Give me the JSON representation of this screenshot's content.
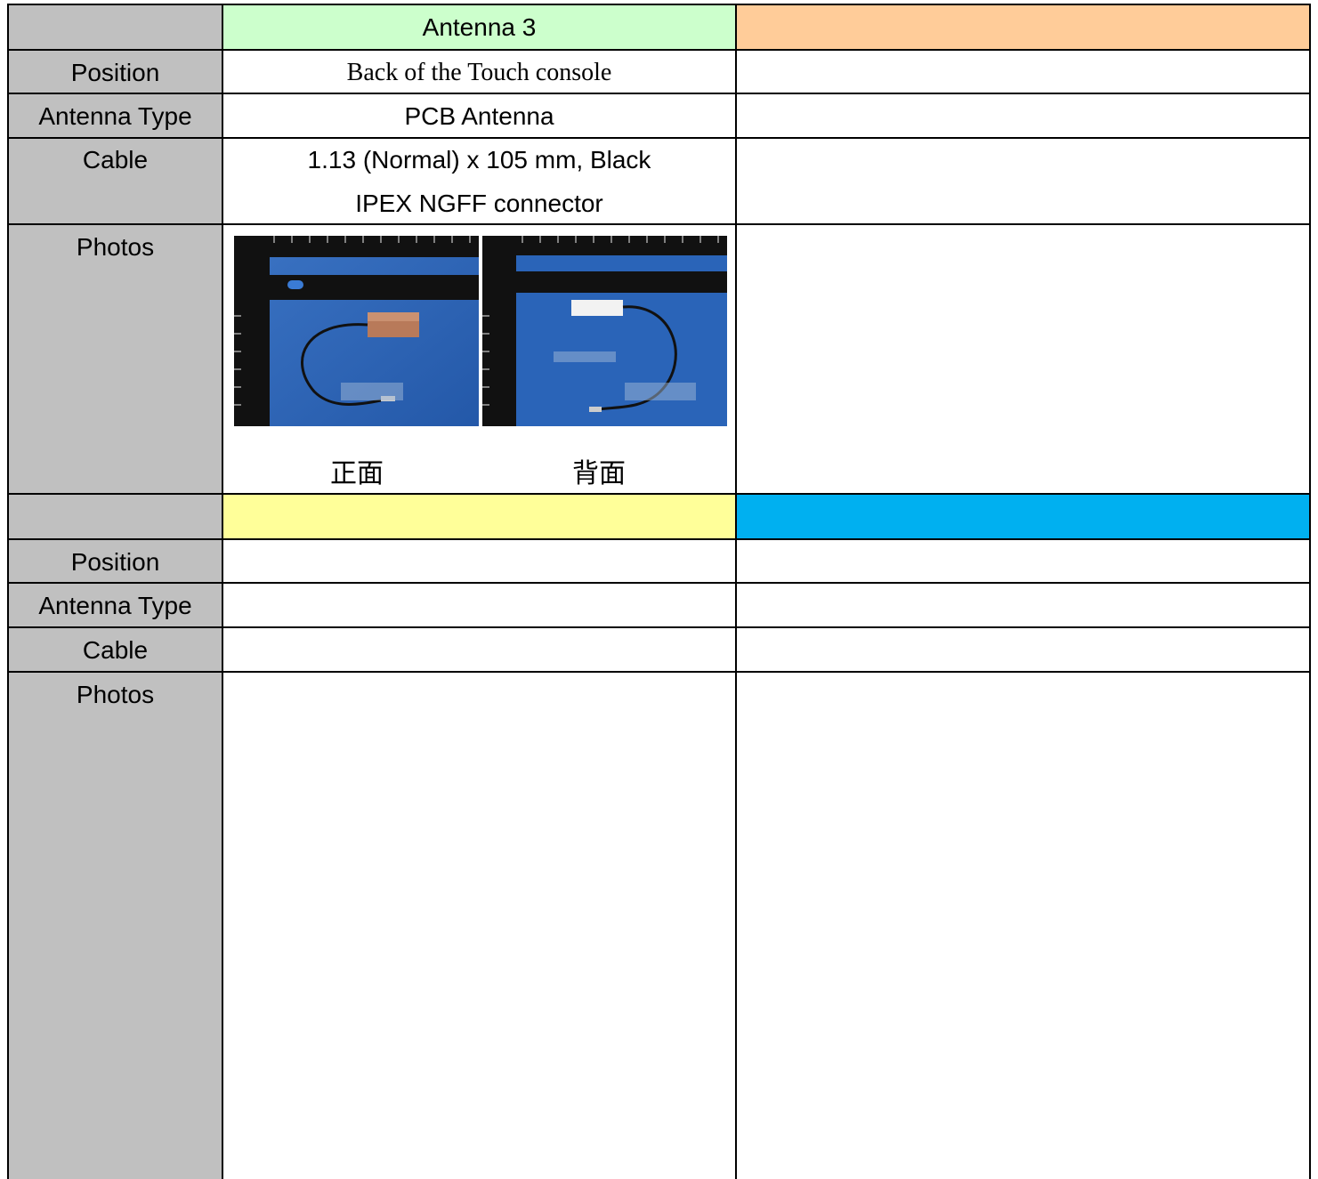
{
  "top_block": {
    "header": "Antenna 3",
    "labels": {
      "position": "Position",
      "antenna_type": "Antenna Type",
      "cable": "Cable",
      "photos": "Photos"
    },
    "position": "Back of the Touch console",
    "antenna_type": "PCB Antenna",
    "cable_lines": [
      "1.13 (Normal) x 105 mm, Black",
      "IPEX NGFF connector"
    ],
    "photo_captions": [
      "正面",
      "背面"
    ]
  },
  "bottom_block": {
    "labels": {
      "position": "Position",
      "antenna_type": "Antenna Type",
      "cable": "Cable",
      "photos": "Photos"
    }
  },
  "colors": {
    "label_bg": "#c0c0c0",
    "antenna3_header": "#ccffcc",
    "orange_header": "#ffcc99",
    "yellow_header": "#ffff99",
    "blue_header": "#00b0f0"
  },
  "icons": [
    "ruler-icon",
    "cable-icon",
    "antenna-pcb-icon"
  ]
}
